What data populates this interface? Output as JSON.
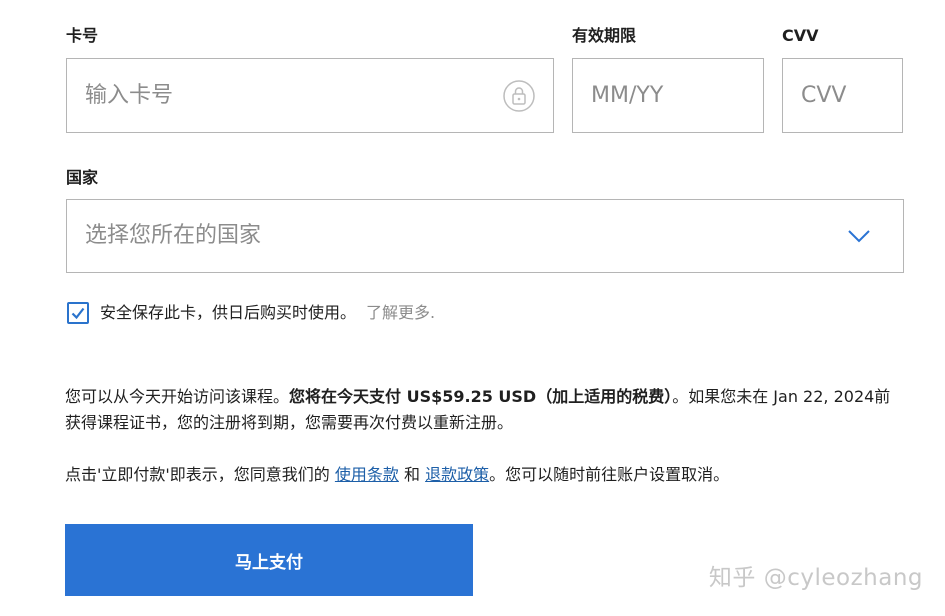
{
  "card": {
    "label": "卡号",
    "placeholder": "输入卡号",
    "lock_icon": "lock-icon"
  },
  "expiry": {
    "label": "有效期限",
    "placeholder": "MM/YY"
  },
  "cvv": {
    "label": "CVV",
    "placeholder": "CVV"
  },
  "country": {
    "label": "国家",
    "placeholder": "选择您所在的国家",
    "icon": "chevron-down-icon"
  },
  "save_card": {
    "checked": true,
    "label": "安全保存此卡，供日后购买时使用。",
    "learn_more": "了解更多."
  },
  "notice": {
    "p1_start": "您可以从今天开始访问该课程。",
    "p1_bold": "您将在今天支付 US$59.25 USD（加上适用的税费）",
    "p1_end": "。如果您未在 Jan 22, 2024前获得课程证书，您的注册将到期，您需要再次付费以重新注册。",
    "p2_start": "点击'立即付款'即表示，您同意我们的 ",
    "terms_link": "使用条款",
    "p2_and": " 和 ",
    "refund_link": "退款政策",
    "p2_end": "。您可以随时前往账户设置取消。"
  },
  "pay_button": {
    "label": "马上支付"
  },
  "watermark": {
    "text": "知乎 @cyleozhang"
  },
  "colors": {
    "accent": "#2a73d4",
    "link": "#1d5fa8",
    "border": "#b5b5b5",
    "placeholder": "#8c8c8c"
  }
}
